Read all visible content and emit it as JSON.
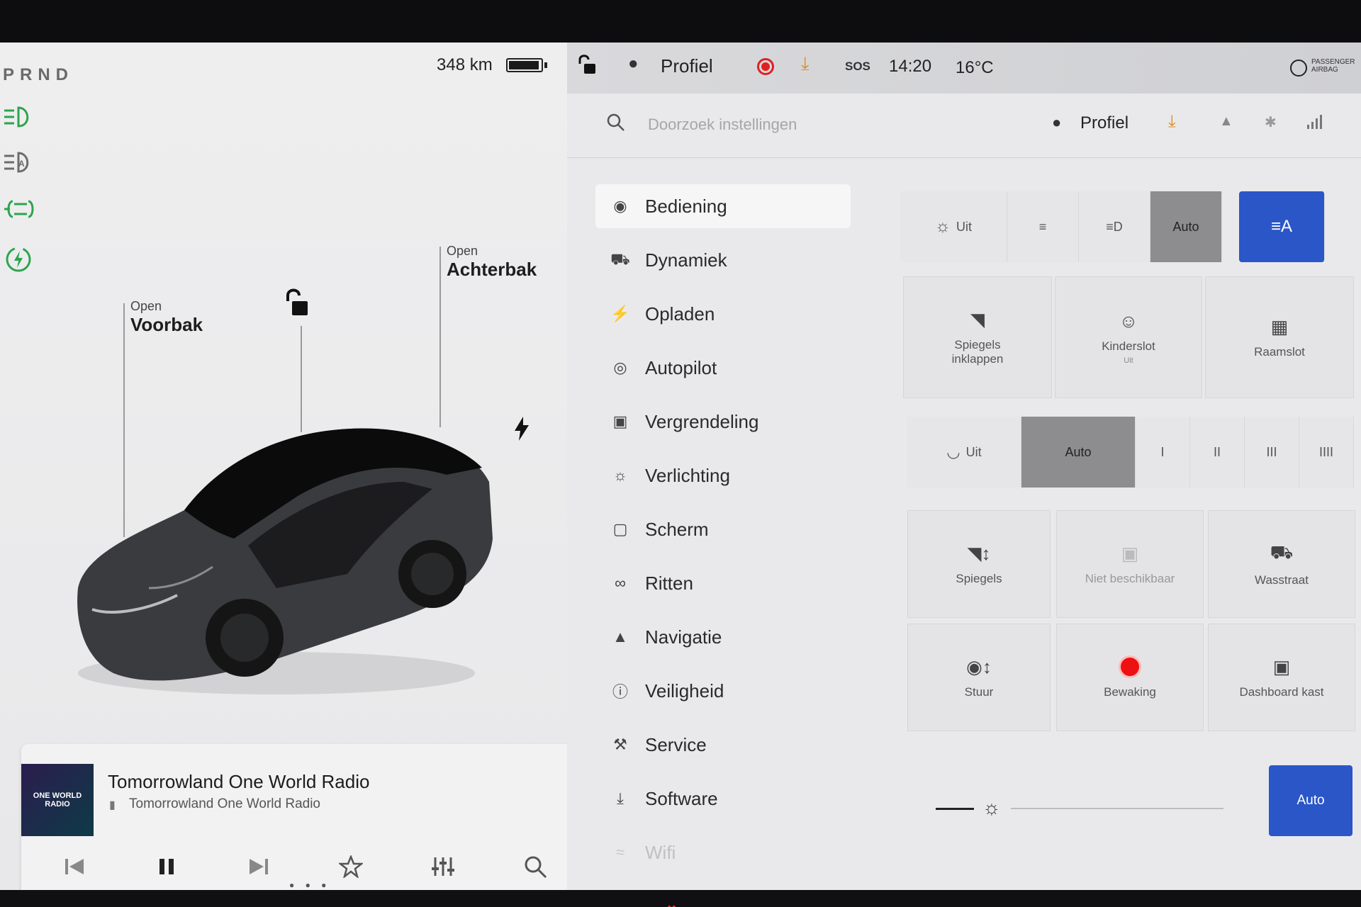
{
  "car_panel": {
    "gear": "PRND",
    "range": "348 km",
    "battery_level": 0.95,
    "frunk": {
      "state": "Open",
      "name": "Voorbak"
    },
    "trunk": {
      "state": "Open",
      "name": "Achterbak"
    },
    "indicator_icons": [
      "headlight-icon",
      "auto-headlight-icon",
      "parking-light-icon",
      "regen-icon"
    ],
    "status_color": "#2da44e"
  },
  "media": {
    "album_art_text": "ONE WORLD RADIO",
    "title": "Tomorrowland One World Radio",
    "subtitle": "Tomorrowland One World Radio",
    "controls": [
      "previous-icon",
      "pause-icon",
      "next-icon",
      "favorite-icon",
      "equalizer-icon",
      "search-icon"
    ]
  },
  "topbar": {
    "profile": "Profiel",
    "sos": "SOS",
    "time": "14:20",
    "temperature": "16°C",
    "airbag": "PASSENGER AIRBAG"
  },
  "search": {
    "placeholder": "Doorzoek instellingen",
    "profile": "Profiel"
  },
  "menu": [
    {
      "label": "Bediening",
      "icon": "toggle-icon",
      "active": true
    },
    {
      "label": "Dynamiek",
      "icon": "car-icon"
    },
    {
      "label": "Opladen",
      "icon": "bolt-icon"
    },
    {
      "label": "Autopilot",
      "icon": "steering-wheel-icon"
    },
    {
      "label": "Vergrendeling",
      "icon": "lock-icon"
    },
    {
      "label": "Verlichting",
      "icon": "sun-icon"
    },
    {
      "label": "Scherm",
      "icon": "screen-icon"
    },
    {
      "label": "Ritten",
      "icon": "trips-icon"
    },
    {
      "label": "Navigatie",
      "icon": "navigation-icon"
    },
    {
      "label": "Veiligheid",
      "icon": "safety-icon"
    },
    {
      "label": "Service",
      "icon": "wrench-icon"
    },
    {
      "label": "Software",
      "icon": "download-icon"
    },
    {
      "label": "Wifi",
      "icon": "wifi-icon"
    }
  ],
  "lights": {
    "off": "Uit",
    "auto": "Auto"
  },
  "tiles_row1": {
    "mirrors_fold": "Spiegels inklappen",
    "child_lock": "Kinderslot",
    "child_lock_sub": "Uit",
    "window_lock": "Raamslot"
  },
  "wipers": {
    "off": "Uit",
    "auto": "Auto",
    "speeds": [
      "I",
      "II",
      "III",
      "IIII"
    ]
  },
  "tiles_row2": {
    "mirrors": "Spiegels",
    "unavailable": "Niet beschikbaar",
    "car_wash": "Wasstraat",
    "steering": "Stuur",
    "sentry": "Bewaking",
    "glovebox": "Dashboard kast"
  },
  "display": {
    "auto": "Auto"
  },
  "colors": {
    "accent_blue": "#2a56c8",
    "record_red": "#dd2222",
    "download_orange": "#e08a1e"
  }
}
